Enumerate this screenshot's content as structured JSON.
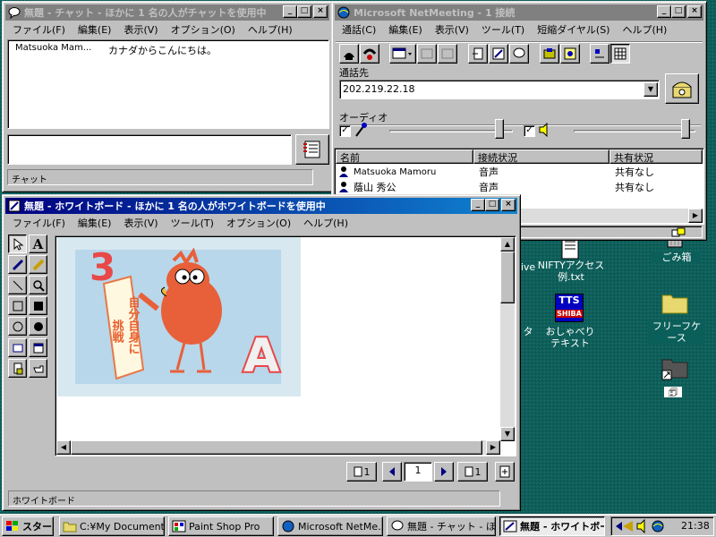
{
  "chat": {
    "title": "無題 - チャット - ほかに 1 名の人がチャットを使用中",
    "menu": [
      "ファイル(F)",
      "編集(E)",
      "表示(V)",
      "オプション(O)",
      "ヘルプ(H)"
    ],
    "messages": [
      {
        "sender": "Matsuoka Mam...",
        "text": "カナダからこんにちは。"
      }
    ],
    "input_value": "",
    "status": "チャット"
  },
  "netmeeting": {
    "title": "Microsoft NetMeeting - 1 接続",
    "menu": [
      "通話(C)",
      "編集(E)",
      "表示(V)",
      "ツール(T)",
      "短縮ダイヤル(S)",
      "ヘルプ(H)"
    ],
    "call_label": "通話先",
    "call_value": "202.219.22.18",
    "audio_label": "オーディオ",
    "mic_level": 0.92,
    "speaker_level": 0.95,
    "columns": [
      "名前",
      "接続状況",
      "共有状況"
    ],
    "rows": [
      {
        "name": "Matsuoka Mamoru",
        "status": "音声",
        "share": "共有なし"
      },
      {
        "name": "蔭山 秀公",
        "status": "音声",
        "share": "共有なし"
      }
    ]
  },
  "whiteboard": {
    "title": "無題 - ホワイトボード - ほかに 1 名の人がホワイトボードを使用中",
    "menu": [
      "ファイル(F)",
      "編集(E)",
      "表示(V)",
      "ツール(T)",
      "オプション(O)",
      "ヘルプ(H)"
    ],
    "page_current": "1",
    "page_total": "1",
    "page_input": "1",
    "page_last": "1",
    "status": "ホワイトボード",
    "drawing_text": {
      "number": "3",
      "letter": "A",
      "banner": [
        "自分自身に",
        "挑戦"
      ]
    }
  },
  "desktop": {
    "icons": [
      {
        "label": "ごみ箱"
      },
      {
        "label": "フリーフケース"
      },
      {
        "label": "NIFTYアクセス例.txt"
      },
      {
        "label": "おしゃべりテキスト"
      },
      {
        "label": "ive"
      },
      {
        "label": "タ"
      }
    ],
    "tts_badge": "TTS",
    "tts_sub": "SHIBA"
  },
  "taskbar": {
    "start_label": "スタート",
    "tasks": [
      "C:¥My Document...",
      "Paint Shop Pro",
      "Microsoft NetMe...",
      "無題 - チャット - ほ...",
      "無題 - ホワイトボー..."
    ],
    "clock": "21:38"
  },
  "colors": {
    "titlebar": "#000080",
    "desktop": "#008080",
    "face": "#c0c0c0"
  }
}
